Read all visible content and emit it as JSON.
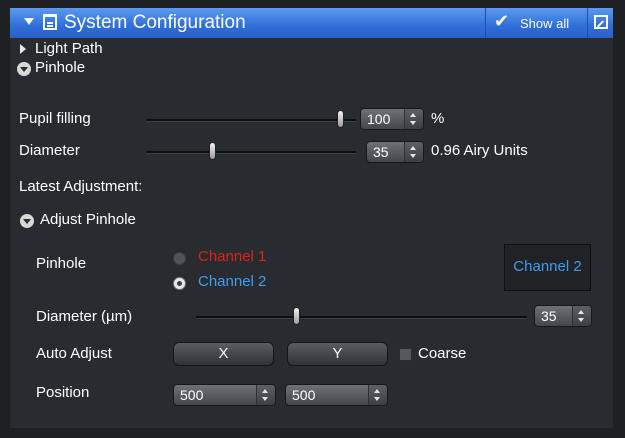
{
  "header": {
    "title": "System Configuration",
    "show_all": "Show all"
  },
  "sections": {
    "light_path": "Light Path",
    "pinhole": "Pinhole"
  },
  "pupil_filling": {
    "label": "Pupil filling",
    "value": "100",
    "unit": "%",
    "fraction": 1.0
  },
  "diameter": {
    "label": "Diameter",
    "value": "35",
    "unit": "0.96 Airy Units",
    "fraction": 0.33
  },
  "latest_adjustment": "Latest Adjustment:",
  "adjust_pinhole": {
    "label": "Adjust Pinhole",
    "pinhole_label": "Pinhole",
    "channel1": "Channel 1",
    "channel2": "Channel 2",
    "selected_channel": "Channel 2",
    "channel_display": "Channel 2",
    "diameter_label": "Diameter (µm)",
    "diameter_value": "35",
    "diameter_fraction": 0.3,
    "auto_adjust_label": "Auto Adjust",
    "x_button": "X",
    "y_button": "Y",
    "coarse_label": "Coarse",
    "coarse_checked": false,
    "position_label": "Position",
    "position_x": "500",
    "position_y": "500"
  },
  "colors": {
    "header": "#2f6ed8",
    "channel1": "#e0221b",
    "channel2": "#3d9df0",
    "panel_bg": "#282b2f"
  }
}
